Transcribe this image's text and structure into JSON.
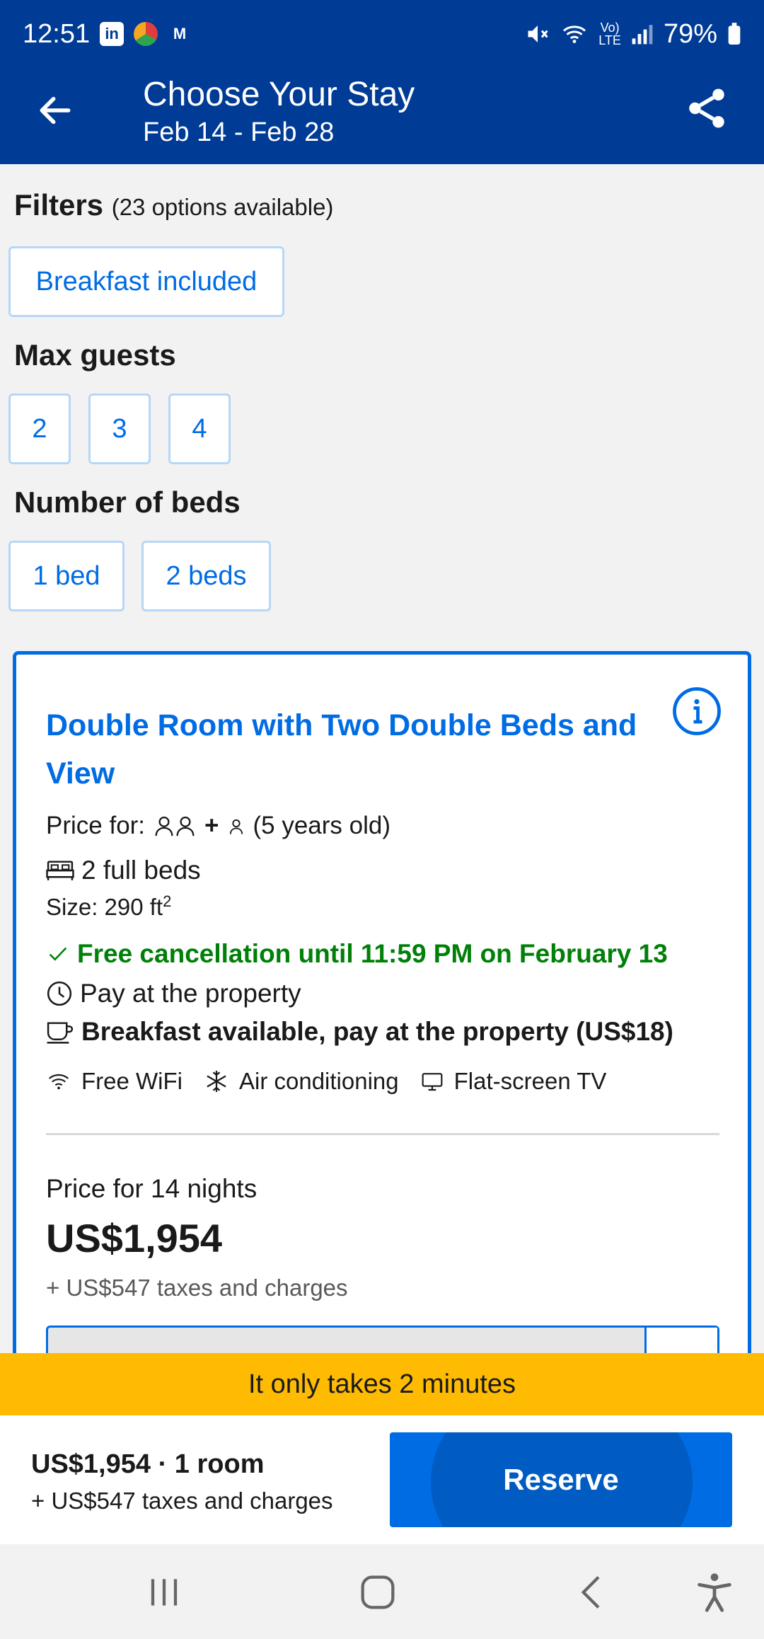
{
  "status_bar": {
    "time": "12:51",
    "battery": "79%",
    "app_icons": [
      "linkedin-icon",
      "browser-icon",
      "m-app-icon"
    ],
    "indicators": [
      "mute-icon",
      "wifi-icon",
      "volte-icon",
      "signal-icon",
      "battery-icon"
    ]
  },
  "header": {
    "title": "Choose Your Stay",
    "dates": "Feb 14 - Feb 28",
    "back_icon": "arrow-left-icon",
    "share_icon": "share-icon",
    "bg_color": "#003b95"
  },
  "filters": {
    "heading": "Filters",
    "count": "(23 options available)",
    "chips": [
      "Breakfast included"
    ]
  },
  "max_guests": {
    "heading": "Max guests",
    "options": [
      "2",
      "3",
      "4"
    ]
  },
  "beds": {
    "heading": "Number of beds",
    "options": [
      "1 bed",
      "2 beds"
    ]
  },
  "room": {
    "title": "Double Room with Two Double Beds and View",
    "price_for_label": "Price for:",
    "price_for_plus": "+",
    "child_age": "(5 years old)",
    "beds": "2 full beds",
    "size_label": "Size: 290 ft",
    "size_sup": "2",
    "cancellation": "Free cancellation until 11:59 PM on February 13",
    "payment": "Pay at the property",
    "breakfast": "Breakfast available, pay at the property (US$18)",
    "amenities": [
      "Free WiFi",
      "Air conditioning",
      "Flat-screen TV"
    ],
    "nights_label": "Price for 14 nights",
    "price": "US$1,954",
    "taxes": "+ US$547 taxes and charges"
  },
  "banner": {
    "text": "It only takes 2 minutes",
    "color": "#febb02"
  },
  "bottom_bar": {
    "summary": "US$1,954 · 1 room",
    "taxes": "+ US$547 taxes and charges",
    "reserve_label": "Reserve",
    "accent": "#006ce4"
  },
  "system_nav": [
    "recents-icon",
    "home-icon",
    "back-icon",
    "accessibility-icon"
  ]
}
